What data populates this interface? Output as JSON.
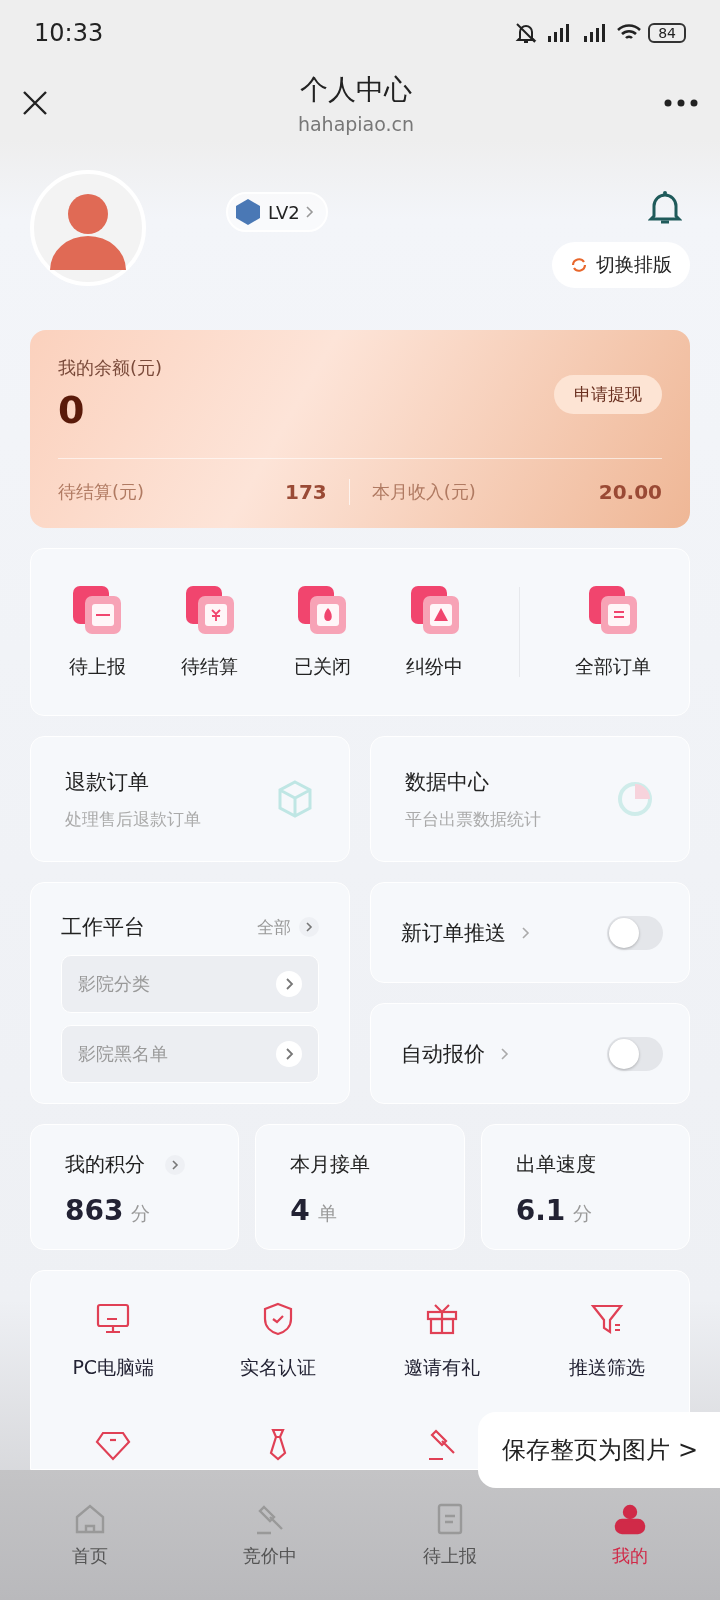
{
  "status_bar": {
    "time": "10:33",
    "battery": "84"
  },
  "header": {
    "title": "个人中心",
    "url": "hahapiao.cn"
  },
  "profile": {
    "level": "LV2",
    "switch_layout": "切换排版"
  },
  "balance": {
    "label": "我的余额(元)",
    "amount": "0",
    "withdraw": "申请提现",
    "pending_label": "待结算(元)",
    "pending_value": "173",
    "month_label": "本月收入(元)",
    "month_value": "20.00"
  },
  "orders": [
    {
      "kind": "report",
      "label": "待上报"
    },
    {
      "kind": "settle",
      "label": "待结算"
    },
    {
      "kind": "closed",
      "label": "已关闭"
    },
    {
      "kind": "dispute",
      "label": "纠纷中"
    },
    {
      "kind": "all",
      "label": "全部订单"
    }
  ],
  "feature_cards": [
    {
      "kind": "refund",
      "title": "退款订单",
      "subtitle": "处理售后退款订单"
    },
    {
      "kind": "data",
      "title": "数据中心",
      "subtitle": "平台出票数据统计"
    }
  ],
  "work_platform": {
    "title": "工作平台",
    "all": "全部",
    "items": [
      "影院分类",
      "影院黑名单"
    ]
  },
  "switches": [
    {
      "label": "新订单推送",
      "on": false
    },
    {
      "label": "自动报价",
      "on": false
    }
  ],
  "stats": [
    {
      "label": "我的积分",
      "value": "863",
      "unit": "分",
      "link": true
    },
    {
      "label": "本月接单",
      "value": "4",
      "unit": "单",
      "link": false
    },
    {
      "label": "出单速度",
      "value": "6.1",
      "unit": "分",
      "link": false
    }
  ],
  "tools": [
    {
      "kind": "pc",
      "label": "PC电脑端"
    },
    {
      "kind": "verify",
      "label": "实名认证"
    },
    {
      "kind": "invite",
      "label": "邀请有礼"
    },
    {
      "kind": "filter",
      "label": "推送筛选"
    },
    {
      "kind": "points"
    },
    {
      "kind": "tie"
    },
    {
      "kind": "quote"
    }
  ],
  "save_popup": "保存整页为图片 >",
  "tabbar": [
    {
      "kind": "home",
      "label": "首页",
      "selected": false
    },
    {
      "kind": "bidding",
      "label": "竞价中",
      "selected": false
    },
    {
      "kind": "report",
      "label": "待上报",
      "selected": false
    },
    {
      "kind": "mine",
      "label": "我的",
      "selected": true
    }
  ]
}
